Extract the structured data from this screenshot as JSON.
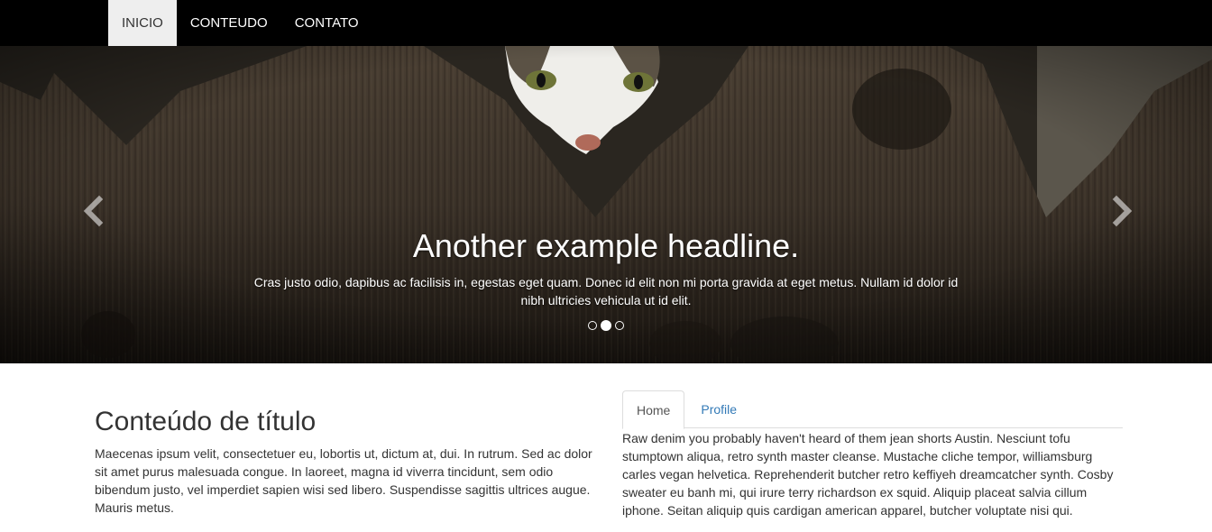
{
  "navbar": {
    "items": [
      {
        "label": "INICIO",
        "active": true
      },
      {
        "label": "CONTEUDO",
        "active": false
      },
      {
        "label": "CONTATO",
        "active": false
      }
    ]
  },
  "carousel": {
    "headline": "Another example headline.",
    "text": "Cras justo odio, dapibus ac facilisis in, egestas eget quam. Donec id elit non mi porta gravida at eget metus. Nullam id dolor id nibh ultricies vehicula ut id elit.",
    "prev_icon": "chevron-left-icon",
    "next_icon": "chevron-right-icon",
    "slide_count": 3,
    "active_slide": 2
  },
  "content": {
    "title": "Conteúdo de título",
    "paragraph": "Maecenas ipsum velit, consectetuer eu, lobortis ut, dictum at, dui. In rutrum. Sed ac dolor sit amet purus malesuada congue. In laoreet, magna id viverra tincidunt, sem odio bibendum justo, vel imperdiet sapien wisi sed libero. Suspendisse sagittis ultrices augue. Mauris metus."
  },
  "tabs": {
    "items": [
      {
        "label": "Home",
        "active": true
      },
      {
        "label": "Profile",
        "active": false
      }
    ],
    "content": "Raw denim you probably haven't heard of them jean shorts Austin. Nesciunt tofu stumptown aliqua, retro synth master cleanse. Mustache cliche tempor, williamsburg carles vegan helvetica. Reprehenderit butcher retro keffiyeh dreamcatcher synth. Cosby sweater eu banh mi, qui irure terry richardson ex squid. Aliquip placeat salvia cillum iphone. Seitan aliquip quis cardigan american apparel, butcher voluptate nisi qui."
  },
  "colors": {
    "navbar_bg": "#000000",
    "nav_active_bg": "#eeeeee",
    "link": "#337ab7",
    "text": "#333333"
  }
}
